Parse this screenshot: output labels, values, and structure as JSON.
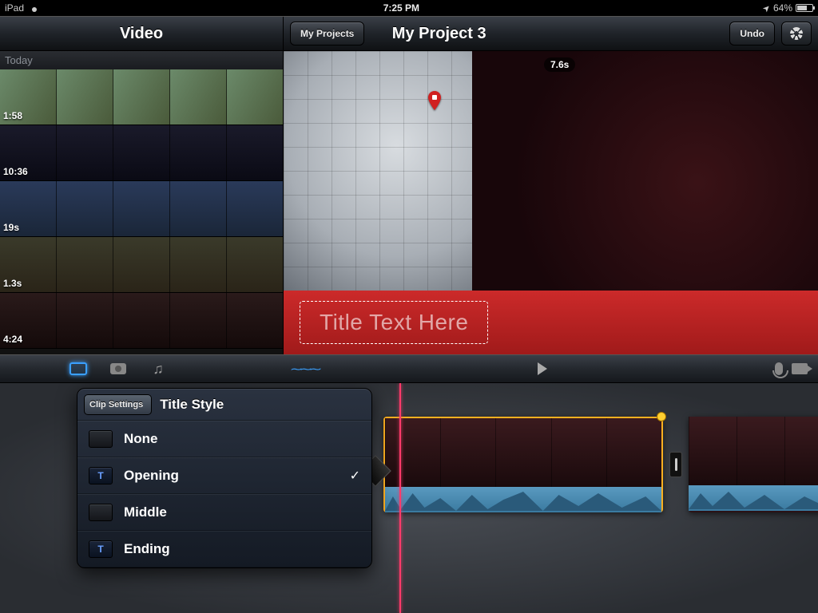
{
  "status": {
    "device": "iPad",
    "time": "7:25 PM",
    "battery_pct": "64%"
  },
  "header": {
    "video_title": "Video",
    "my_projects": "My Projects",
    "project_title": "My Project 3",
    "undo": "Undo"
  },
  "media": {
    "section": "Today",
    "clips": [
      {
        "duration": "1:58"
      },
      {
        "duration": "10:36"
      },
      {
        "duration": "19s"
      },
      {
        "duration": "1.3s"
      },
      {
        "duration": "4:24"
      }
    ]
  },
  "preview": {
    "time_badge": "7.6s",
    "title_placeholder": "Title Text Here"
  },
  "popover": {
    "back": "Clip Settings",
    "title": "Title Style",
    "items": [
      {
        "label": "None",
        "selected": false,
        "has_t": false
      },
      {
        "label": "Opening",
        "selected": true,
        "has_t": true
      },
      {
        "label": "Middle",
        "selected": false,
        "has_t": false
      },
      {
        "label": "Ending",
        "selected": false,
        "has_t": true
      }
    ]
  },
  "checkmark": "✓",
  "location_arrow": "➤"
}
